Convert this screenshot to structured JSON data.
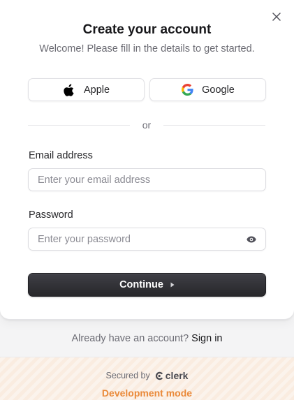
{
  "dialog": {
    "title": "Create your account",
    "subtitle": "Welcome! Please fill in the details to get started.",
    "close_icon": "close-icon"
  },
  "social": {
    "apple": {
      "label": "Apple",
      "icon": "apple-icon"
    },
    "google": {
      "label": "Google",
      "icon": "google-icon"
    }
  },
  "divider": {
    "text": "or"
  },
  "email": {
    "label": "Email address",
    "value": "",
    "placeholder": "Enter your email address"
  },
  "password": {
    "label": "Password",
    "value": "",
    "placeholder": "Enter your password",
    "toggle_icon": "eye-icon"
  },
  "continue": {
    "label": "Continue",
    "icon": "caret-right-icon"
  },
  "footer": {
    "signin_prompt": "Already have an account?",
    "signin_link": "Sign in",
    "secured_by": "Secured by",
    "brand": "clerk",
    "dev_mode": "Development mode"
  },
  "colors": {
    "primary_button": "#2f2f33",
    "dev_mode_accent": "#ea8a3a",
    "google_blue": "#4285F4",
    "google_red": "#EA4335",
    "google_yellow": "#FBBC05",
    "google_green": "#34A853"
  }
}
